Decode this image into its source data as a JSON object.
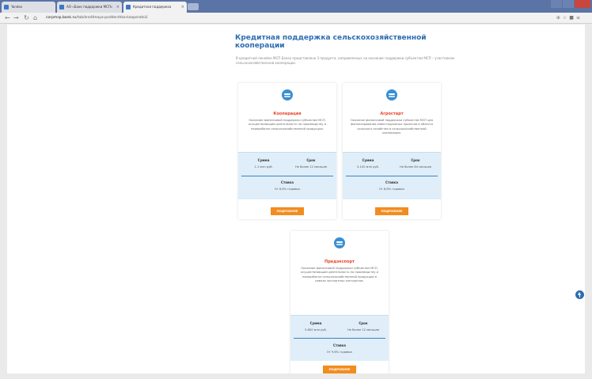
{
  "browser": {
    "tabs": [
      {
        "label": "Yandex"
      },
      {
        "label": "АО «Банк поддержки МСП»"
      },
      {
        "label": "Кредитная поддержка"
      }
    ],
    "url_host": "corpmsp.bank.ru",
    "url_path": "/tab/kreditnaya-podderzhka-kooperatsii/"
  },
  "page": {
    "title": "Кредитная поддержка сельскохозяйственной кооперации",
    "intro": "В кредитной линейке МСП Банка представлено 3 продукта, направленных на оказание поддержки субъектам МСП – участникам сельскохозяйственной кооперации."
  },
  "cards": [
    {
      "title": "Кооперация",
      "description": "Оказание финансовой поддержки субъектам МСП, осуществляющим деятельность по производству и переработке сельскохозяйственной продукции.",
      "sum_label": "Сумма",
      "sum_value": "1-1 млн руб.",
      "term_label": "Срок",
      "term_value": "Не более 12 месяцев",
      "rate_label": "Ставка",
      "rate_value": "От 8,6% годовых",
      "button": "ПОДРОБНЕЕ"
    },
    {
      "title": "Агростарт",
      "description": "Оказание финансовой поддержки субъектам МСП для финансирования инвестиционных проектов в области сельского хозяйства и сельскохозяйственной кооперации.",
      "sum_label": "Сумма",
      "sum_value": "5-100 млн руб.",
      "term_label": "Срок",
      "term_value": "Не более 84 месяцев",
      "rate_label": "Ставка",
      "rate_value": "От 8,6% годовых",
      "button": "ПОДРОБНЕЕ"
    },
    {
      "title": "Предэкспорт",
      "description": "Оказание финансовой поддержки субъектам МСП, осуществляющим деятельность по производству и переработке сельскохозяйственной продукции в рамках экспортных контрактов.",
      "sum_label": "Сумма",
      "sum_value": "5-800 млн руб.",
      "term_label": "Срок",
      "term_value": "Не более 12 месяцев",
      "rate_label": "Ставка",
      "rate_value": "От 9,6% годовых",
      "button": "ПОДРОБНЕЕ"
    }
  ],
  "colors": {
    "accent": "#2d6db2",
    "button": "#f28c1e",
    "card_title": "#e8442b",
    "stats_bg": "#dfeef8"
  }
}
